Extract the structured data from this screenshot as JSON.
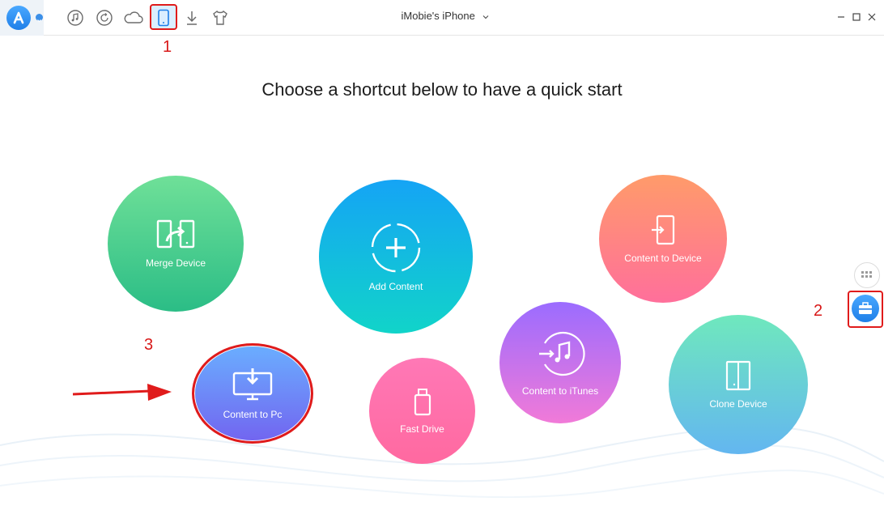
{
  "topbar": {
    "device_title": "iMobie's iPhone",
    "icons": [
      "music-icon",
      "restore-icon",
      "cloud-icon",
      "device-icon",
      "download-icon",
      "shirt-icon"
    ]
  },
  "headline": "Choose a shortcut below to have a quick start",
  "annotations": {
    "one": "1",
    "two": "2",
    "three": "3"
  },
  "shortcuts": {
    "merge_device": "Merge Device",
    "add_content": "Add Content",
    "content_to_device": "Content to Device",
    "content_to_pc": "Content to Pc",
    "fast_drive": "Fast Drive",
    "content_to_itunes": "Content to iTunes",
    "clone_device": "Clone Device"
  },
  "colors": {
    "accent": "#1f7fe8",
    "annotation_red": "#e01b1b"
  }
}
